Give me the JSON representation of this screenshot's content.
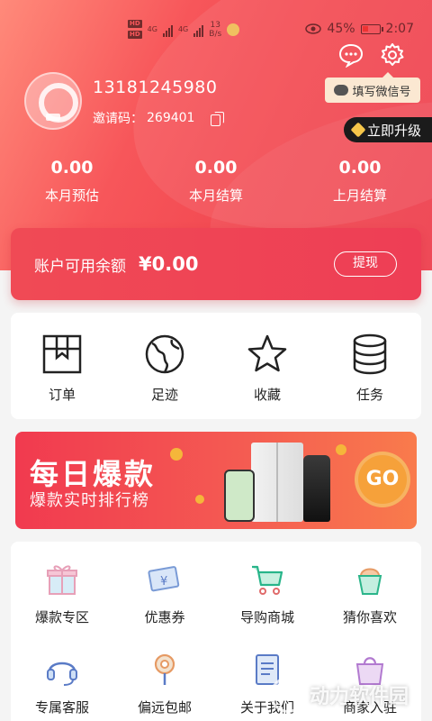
{
  "status_bar": {
    "hd1": "HD",
    "hd2": "HD",
    "net1": "4G",
    "net2": "4G",
    "speed_value": "13",
    "speed_unit": "B/s",
    "battery": "45%",
    "time": "2:07"
  },
  "profile": {
    "phone": "13181245980",
    "invite_label": "邀请码：",
    "invite_code": "269401",
    "wechat_tip": "填写微信号",
    "upgrade_label": "立即升级"
  },
  "stats": [
    {
      "value": "0.00",
      "label": "本月预估"
    },
    {
      "value": "0.00",
      "label": "本月结算"
    },
    {
      "value": "0.00",
      "label": "上月结算"
    }
  ],
  "balance": {
    "label": "账户可用余额",
    "value": "¥0.00",
    "withdraw_label": "提现"
  },
  "quick_menu": [
    {
      "label": "订单",
      "icon": "order-box-icon"
    },
    {
      "label": "足迹",
      "icon": "globe-icon"
    },
    {
      "label": "收藏",
      "icon": "star-icon"
    },
    {
      "label": "任务",
      "icon": "database-icon"
    }
  ],
  "banner": {
    "title": "每日爆款",
    "subtitle": "爆款实时排行榜",
    "go_label": "GO"
  },
  "services": [
    {
      "label": "爆款专区",
      "icon": "gift-icon"
    },
    {
      "label": "优惠券",
      "icon": "coupon-icon"
    },
    {
      "label": "导购商城",
      "icon": "shopping-cart-icon"
    },
    {
      "label": "猜你喜欢",
      "icon": "ice-cream-icon"
    },
    {
      "label": "专属客服",
      "icon": "headset-icon"
    },
    {
      "label": "偏远包邮",
      "icon": "location-pin-icon"
    },
    {
      "label": "关于我们",
      "icon": "document-icon"
    },
    {
      "label": "商家入驻",
      "icon": "handbag-icon"
    }
  ],
  "watermark": "动力软件园",
  "colors": {
    "brand_red": "#f24a52",
    "tip_bg": "#fbe8d2",
    "upgrade_bg": "#1b1b1b",
    "gold": "#f6c64a"
  }
}
